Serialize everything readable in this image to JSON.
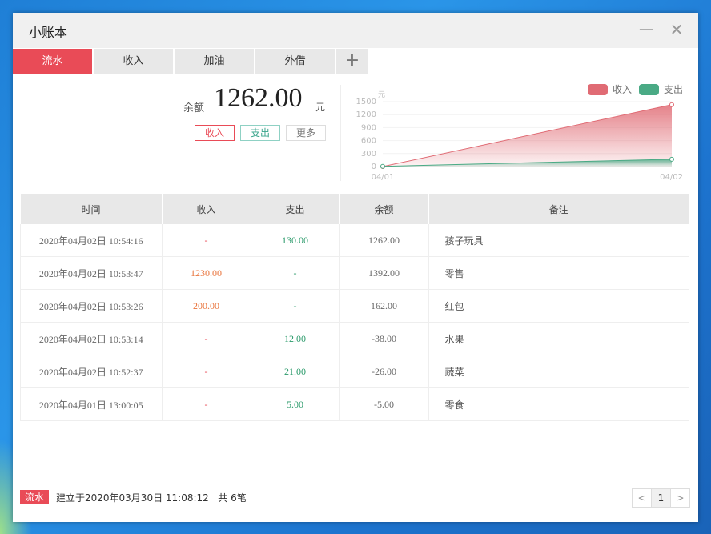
{
  "window": {
    "title": "小账本",
    "minimize_icon": "minimize-icon",
    "close_icon": "close-icon"
  },
  "tabs": [
    {
      "label": "流水",
      "active": true
    },
    {
      "label": "收入",
      "active": false
    },
    {
      "label": "加油",
      "active": false
    },
    {
      "label": "外借",
      "active": false
    }
  ],
  "add_tab_icon": "plus-icon",
  "summary": {
    "balance_label": "余额",
    "balance_value": "1262.00",
    "unit": "元",
    "buttons": {
      "income": "收入",
      "expense": "支出",
      "more": "更多"
    }
  },
  "chart_data": {
    "type": "area",
    "unit_label": "元",
    "x": [
      "04/01",
      "04/02"
    ],
    "ylim": [
      0,
      1500
    ],
    "yticks": [
      0,
      300,
      600,
      900,
      1200,
      1500
    ],
    "series": [
      {
        "name": "收入",
        "values": [
          0,
          1430
        ],
        "color": "#e06b74"
      },
      {
        "name": "支出",
        "values": [
          5,
          168
        ],
        "color": "#4aaa85"
      }
    ],
    "legend_placement": "top-right"
  },
  "table": {
    "columns": [
      "时间",
      "收入",
      "支出",
      "余额",
      "备注"
    ],
    "rows": [
      {
        "time": "2020年04月02日 10:54:16",
        "income": "-",
        "expense": "130.00",
        "balance": "1262.00",
        "note": "孩子玩具"
      },
      {
        "time": "2020年04月02日 10:53:47",
        "income": "1230.00",
        "expense": "-",
        "balance": "1392.00",
        "note": "零售"
      },
      {
        "time": "2020年04月02日 10:53:26",
        "income": "200.00",
        "expense": "-",
        "balance": "162.00",
        "note": "红包"
      },
      {
        "time": "2020年04月02日 10:53:14",
        "income": "-",
        "expense": "12.00",
        "balance": "-38.00",
        "note": "水果"
      },
      {
        "time": "2020年04月02日 10:52:37",
        "income": "-",
        "expense": "21.00",
        "balance": "-26.00",
        "note": "蔬菜"
      },
      {
        "time": "2020年04月01日 13:00:05",
        "income": "-",
        "expense": "5.00",
        "balance": "-5.00",
        "note": "零食"
      }
    ]
  },
  "footer": {
    "tag": "流水",
    "created": "建立于2020年03月30日 11:08:12",
    "count": "共 6笔"
  },
  "pagination": {
    "prev": "<",
    "current": "1",
    "next": ">"
  }
}
